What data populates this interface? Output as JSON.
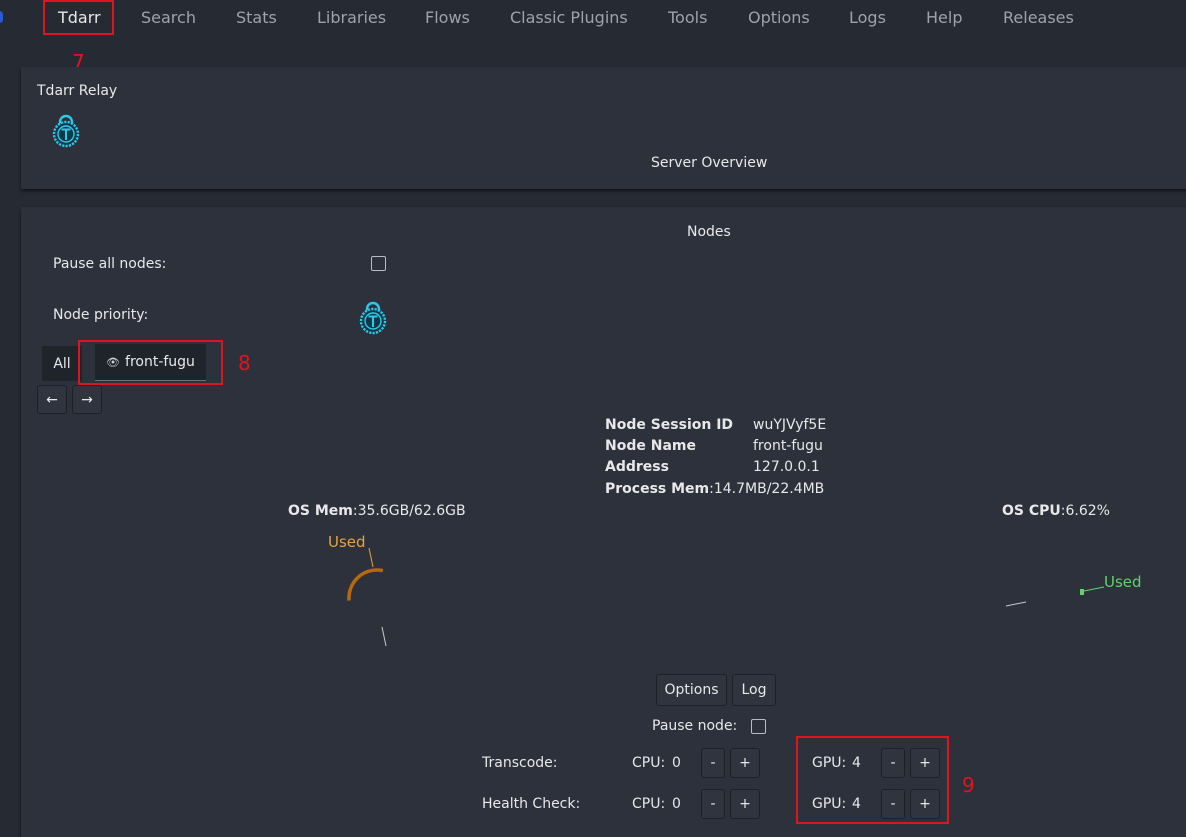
{
  "nav": {
    "items": [
      "Tdarr",
      "Search",
      "Stats",
      "Libraries",
      "Flows",
      "Classic Plugins",
      "Tools",
      "Options",
      "Logs",
      "Help",
      "Releases"
    ]
  },
  "relay": {
    "title": "Tdarr Relay",
    "server_overview": "Server Overview"
  },
  "nodes": {
    "title": "Nodes",
    "pause_all_label": "Pause all nodes:",
    "node_priority_label": "Node priority:",
    "tabs": [
      "All",
      "front-fugu"
    ],
    "nav_prev": "←",
    "nav_next": "→",
    "info": [
      {
        "key": "Node Session ID",
        "value": "wuYJVyf5E"
      },
      {
        "key": "Node Name",
        "value": "front-fugu"
      },
      {
        "key": "Address",
        "value": "127.0.0.1"
      },
      {
        "key": "Process Mem",
        "value": ":14.7MB/22.4MB"
      }
    ],
    "os_mem": {
      "label": "OS Mem",
      "value": ":35.6GB/62.6GB",
      "legend": "Used",
      "used": 35.6,
      "total": 62.6,
      "color": "#b8690a",
      "legend_color": "#e8a33a"
    },
    "os_cpu": {
      "label": "OS CPU",
      "value": ":6.62%",
      "legend": "Used",
      "percent": 6.62,
      "color": "#5fd36a"
    },
    "options_button": "Options",
    "log_button": "Log",
    "pause_node_label": "Pause node:",
    "workers": [
      {
        "label": "Transcode:",
        "cpu_label": "CPU:",
        "cpu_value": "0",
        "gpu_label": "GPU:",
        "gpu_value": "4",
        "minus": "-",
        "plus": "+"
      },
      {
        "label": "Health Check:",
        "cpu_label": "CPU:",
        "cpu_value": "0",
        "gpu_label": "GPU:",
        "gpu_value": "4",
        "minus": "-",
        "plus": "+"
      }
    ]
  },
  "annotations": [
    "7",
    "8",
    "9"
  ],
  "colors": {
    "background": "#262a33",
    "panel": "#2c313b",
    "highlight": "#e0141e",
    "lock_icon": "#2ec8e8"
  },
  "icons": [
    "lock-icon",
    "eye-icon",
    "arrow-left-icon",
    "arrow-right-icon"
  ]
}
